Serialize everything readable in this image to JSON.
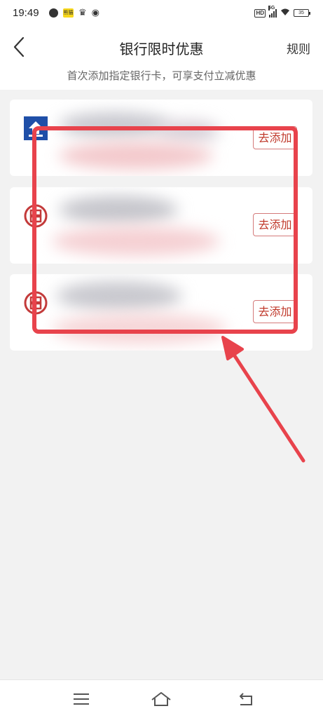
{
  "status_bar": {
    "time": "19:49",
    "news_badge": "熊猫",
    "network": "5G",
    "hd": "HD",
    "battery": "35"
  },
  "nav": {
    "title": "银行限时优惠",
    "rules": "规则"
  },
  "subtitle": "首次添加指定银行卡，可享支付立减优惠",
  "cards": [
    {
      "bank_logo": "blue-bank-logo-icon",
      "add_label": "去添加"
    },
    {
      "bank_logo": "red-bank-logo-icon",
      "add_label": "去添加"
    },
    {
      "bank_logo": "red-bank-logo-icon",
      "add_label": "去添加"
    }
  ],
  "colors": {
    "accent_red": "#c0392b",
    "annotation_red": "#e8434c",
    "bank_blue": "#1f4fa8",
    "bank_red": "#c33a3a"
  }
}
